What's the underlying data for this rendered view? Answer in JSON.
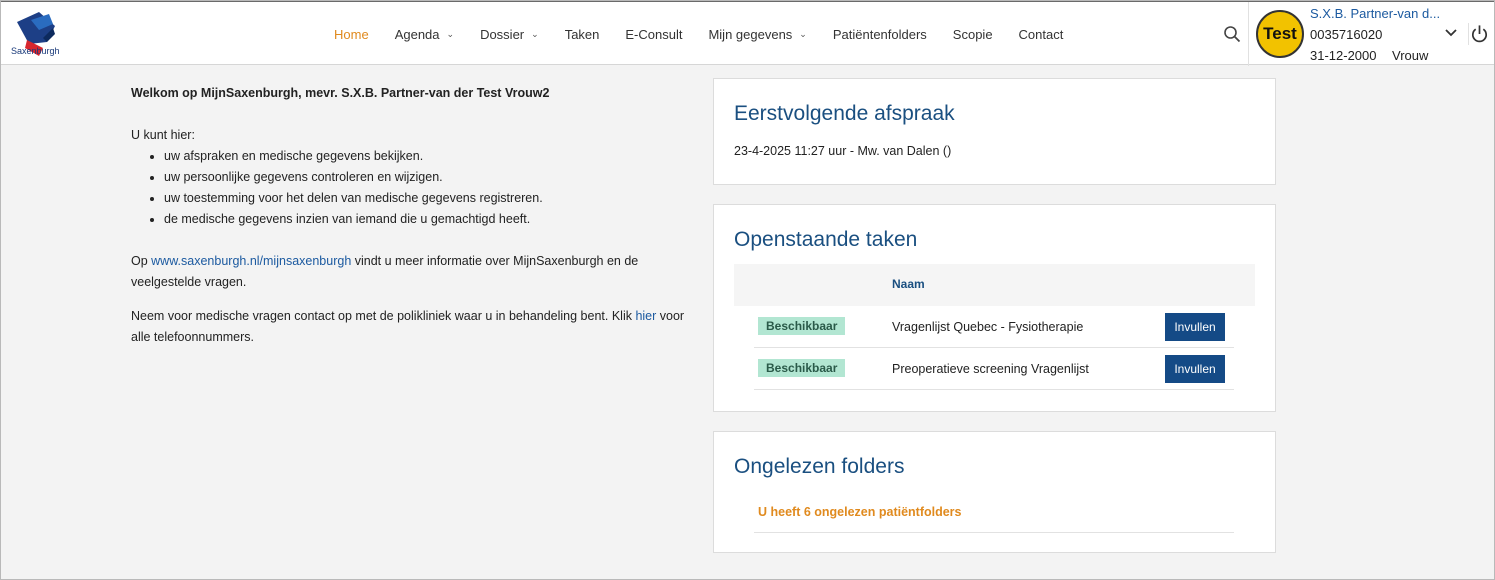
{
  "brand": {
    "logo_text": "Saxenburgh"
  },
  "nav": {
    "items": [
      {
        "label": "Home",
        "active": true,
        "dropdown": false
      },
      {
        "label": "Agenda",
        "dropdown": true
      },
      {
        "label": "Dossier",
        "dropdown": true
      },
      {
        "label": "Taken",
        "dropdown": false
      },
      {
        "label": "E-Consult",
        "dropdown": false
      },
      {
        "label": "Mijn gegevens",
        "dropdown": true
      },
      {
        "label": "Patiëntenfolders",
        "dropdown": false
      },
      {
        "label": "Scopie",
        "dropdown": false
      },
      {
        "label": "Contact",
        "dropdown": false
      }
    ]
  },
  "user": {
    "avatar_text": "Test",
    "name": "S.X.B. Partner-van d...",
    "id": "0035716020",
    "dob": "31-12-2000",
    "gender": "Vrouw"
  },
  "welcome": {
    "title": "Welkom op MijnSaxenburgh, mevr. S.X.B. Partner-van der Test Vrouw2",
    "intro": "U kunt hier:",
    "bullets": [
      "uw afspraken en medische gegevens bekijken.",
      "uw persoonlijke gegevens controleren en wijzigen.",
      "uw toestemming voor het delen van medische gegevens registreren.",
      "de medische gegevens inzien van iemand die u gemachtigd heeft."
    ],
    "info_pre": "Op ",
    "info_link": "www.saxenburgh.nl/mijnsaxenburgh",
    "info_post": " vindt u meer informatie over MijnSaxenburgh en de veelgestelde vragen.",
    "contact_pre": "Neem voor medische vragen contact op met de polikliniek waar u in behandeling bent. Klik ",
    "contact_link": "hier",
    "contact_post": " voor alle telefoonnummers."
  },
  "appointment": {
    "title": "Eerstvolgende afspraak",
    "text": "23-4-2025 11:27 uur - Mw. van Dalen ()"
  },
  "tasks": {
    "title": "Openstaande taken",
    "column_name": "Naam",
    "rows": [
      {
        "status": "Beschikbaar",
        "name": "Vragenlijst Quebec - Fysiotherapie",
        "action": "Invullen"
      },
      {
        "status": "Beschikbaar",
        "name": "Preoperatieve screening Vragenlijst",
        "action": "Invullen"
      }
    ]
  },
  "folders": {
    "title": "Ongelezen folders",
    "link": "U heeft 6 ongelezen patiëntfolders"
  },
  "colors": {
    "accent": "#e08a1e",
    "primary": "#144a86",
    "heading": "#1a4f80",
    "badge_bg": "#b2e6d2"
  }
}
